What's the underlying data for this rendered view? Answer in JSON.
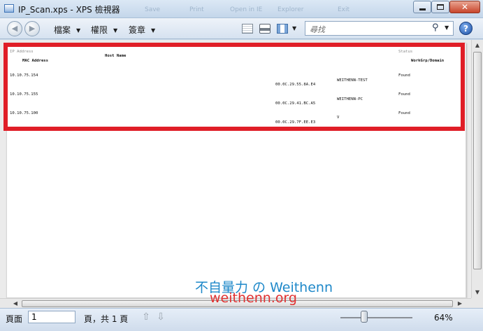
{
  "window": {
    "title": "IP_Scan.xps - XPS 檢視器",
    "ghost_labels": [
      "Save",
      "Print",
      "Open in IE",
      "Explorer",
      "Exit"
    ]
  },
  "toolbar": {
    "menus": [
      "檔案",
      "權限",
      "簽章"
    ],
    "search_placeholder": "尋找"
  },
  "document": {
    "headers": {
      "ip_address": "IP Address",
      "host_name": "Host Name",
      "mac_address": "MAC Address",
      "status": "Status",
      "workgroup": "WorkGrp/Domain"
    },
    "rows": [
      {
        "ip": "10.10.75.154",
        "status": "Found",
        "host": "WEITHENN-TEST",
        "mac": "00.0C.29.55.8A.E4"
      },
      {
        "ip": "10.10.75.155",
        "status": "Found",
        "host": "WEITHENN-PC",
        "mac": "00.0C.29.41.BC.A5"
      },
      {
        "ip": "10.10.75.100",
        "status": "Found",
        "host": "V",
        "mac": "00.0C.29.7F.EE.E3"
      }
    ]
  },
  "statusbar": {
    "page_label": "頁面",
    "page_value": "1",
    "page_total": "頁，共 1 頁",
    "zoom": "64%",
    "zoom_fraction": 0.33
  },
  "watermark": {
    "line1": "不自量力 の Weithenn",
    "line2": "weithenn.org"
  },
  "colors": {
    "highlight": "#e01e27",
    "watermark_blue": "#1e88c9",
    "watermark_red": "#e03030"
  }
}
